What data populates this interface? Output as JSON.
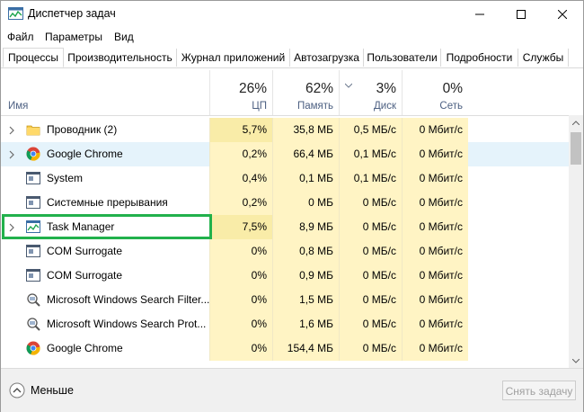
{
  "window": {
    "title": "Диспетчер задач"
  },
  "menu": [
    "Файл",
    "Параметры",
    "Вид"
  ],
  "tabs": [
    "Процессы",
    "Производительность",
    "Журнал приложений",
    "Автозагрузка",
    "Пользователи",
    "Подробности",
    "Службы"
  ],
  "active_tab": "Процессы",
  "columns": {
    "name": "Имя",
    "cpu": {
      "pct": "26%",
      "label": "ЦП"
    },
    "memory": {
      "pct": "62%",
      "label": "Память"
    },
    "disk": {
      "pct": "3%",
      "label": "Диск"
    },
    "network": {
      "pct": "0%",
      "label": "Сеть"
    }
  },
  "processes": [
    {
      "name": "Проводник (2)",
      "icon": "folder-icon",
      "expandable": true,
      "cpu": "5,7%",
      "memory": "35,8 МБ",
      "disk": "0,5 МБ/с",
      "network": "0 Мбит/с"
    },
    {
      "name": "Google Chrome",
      "icon": "chrome-icon",
      "expandable": true,
      "cpu": "0,2%",
      "memory": "66,4 МБ",
      "disk": "0,1 МБ/с",
      "network": "0 Мбит/с"
    },
    {
      "name": "System",
      "icon": "system-icon",
      "expandable": false,
      "cpu": "0,4%",
      "memory": "0,1 МБ",
      "disk": "0,1 МБ/с",
      "network": "0 Мбит/с"
    },
    {
      "name": "Системные прерывания",
      "icon": "system-icon",
      "expandable": false,
      "cpu": "0,2%",
      "memory": "0 МБ",
      "disk": "0 МБ/с",
      "network": "0 Мбит/с"
    },
    {
      "name": "Task Manager",
      "icon": "task-manager-icon",
      "expandable": true,
      "cpu": "7,5%",
      "memory": "8,9 МБ",
      "disk": "0 МБ/с",
      "network": "0 Мбит/с"
    },
    {
      "name": "COM Surrogate",
      "icon": "system-icon",
      "expandable": false,
      "cpu": "0%",
      "memory": "0,8 МБ",
      "disk": "0 МБ/с",
      "network": "0 Мбит/с"
    },
    {
      "name": "COM Surrogate",
      "icon": "system-icon",
      "expandable": false,
      "cpu": "0%",
      "memory": "0,9 МБ",
      "disk": "0 МБ/с",
      "network": "0 Мбит/с"
    },
    {
      "name": "Microsoft Windows Search Filter...",
      "icon": "search-service-icon",
      "expandable": false,
      "cpu": "0%",
      "memory": "1,5 МБ",
      "disk": "0 МБ/с",
      "network": "0 Мбит/с"
    },
    {
      "name": "Microsoft Windows Search Prot...",
      "icon": "search-service-icon",
      "expandable": false,
      "cpu": "0%",
      "memory": "1,6 МБ",
      "disk": "0 МБ/с",
      "network": "0 Мбит/с"
    },
    {
      "name": "Google Chrome",
      "icon": "chrome-icon",
      "expandable": false,
      "cpu": "0%",
      "memory": "154,4 МБ",
      "disk": "0 МБ/с",
      "network": "0 Мбит/с"
    }
  ],
  "footer": {
    "less_label": "Меньше",
    "end_task_label": "Снять задачу"
  },
  "colors": {
    "heat_light": "#fff4c4",
    "heat_medium": "#f9eca8",
    "highlight": "#22b14c",
    "hover": "#e5f3fb"
  }
}
